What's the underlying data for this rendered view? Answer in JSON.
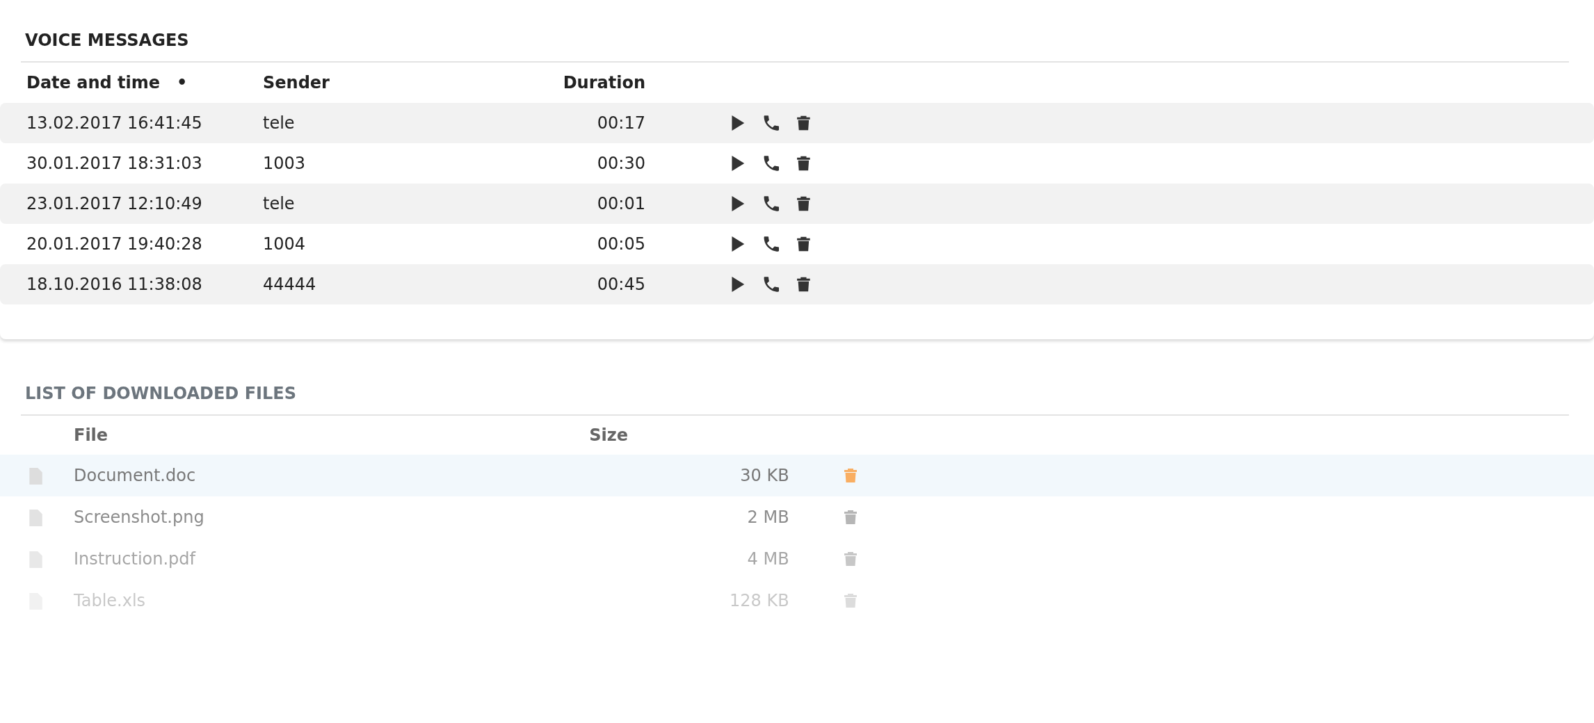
{
  "voice_messages": {
    "title": "VOICE MESSAGES",
    "columns": [
      {
        "label": "Date and time",
        "sort_mark": "•"
      },
      {
        "label": "Sender"
      },
      {
        "label": "Duration"
      }
    ],
    "rows": [
      {
        "date_time": "13.02.2017 16:41:45",
        "sender": "tele",
        "duration": "00:17"
      },
      {
        "date_time": "30.01.2017 18:31:03",
        "sender": "1003",
        "duration": "00:30"
      },
      {
        "date_time": "23.01.2017 12:10:49",
        "sender": "tele",
        "duration": "00:01"
      },
      {
        "date_time": "20.01.2017 19:40:28",
        "sender": "1004",
        "duration": "00:05"
      },
      {
        "date_time": "18.10.2016 11:38:08",
        "sender": "44444",
        "duration": "00:45"
      }
    ]
  },
  "downloaded_files": {
    "title": "LIST OF DOWNLOADED FILES",
    "columns": [
      {
        "label": "File"
      },
      {
        "label": "Size"
      }
    ],
    "rows": [
      {
        "file": "Document.doc",
        "size": "30 KB",
        "selected": true
      },
      {
        "file": "Screenshot.png",
        "size": "2 MB",
        "selected": false
      },
      {
        "file": "Instruction.pdf",
        "size": "4 MB",
        "selected": false
      },
      {
        "file": "Table.xls",
        "size": "128 KB",
        "selected": false
      }
    ]
  }
}
